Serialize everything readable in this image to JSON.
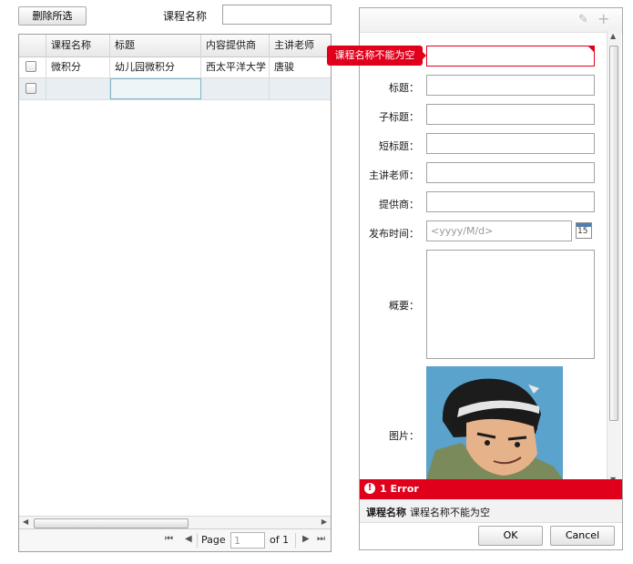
{
  "toolbar": {
    "delete_button": "删除所选",
    "course_name_label": "课程名称",
    "course_name_value": ""
  },
  "grid": {
    "columns": [
      "课程名称",
      "标题",
      "内容提供商",
      "主讲老师"
    ],
    "rows": [
      {
        "cells": [
          "微积分",
          "幼儿园微积分",
          "西太平洋大学",
          "唐骏"
        ]
      },
      {
        "cells": [
          "",
          "",
          "",
          ""
        ]
      }
    ],
    "pager": {
      "page_label": "Page",
      "page_value": "1",
      "of_label": "of 1"
    }
  },
  "form": {
    "error_tooltip": "课程名称不能为空",
    "fields": {
      "title": {
        "label": "标题："
      },
      "subtitle": {
        "label": "子标题："
      },
      "short_title": {
        "label": "短标题："
      },
      "teacher": {
        "label": "主讲老师："
      },
      "provider": {
        "label": "提供商："
      },
      "publish_time": {
        "label": "发布时间：",
        "placeholder": "<yyyy/M/d>"
      },
      "summary": {
        "label": "概要："
      },
      "image": {
        "label": "图片："
      }
    },
    "calendar_day": "15",
    "error_bar": {
      "title": "1 Error"
    },
    "error_detail": {
      "field": "课程名称",
      "message": "课程名称不能为空"
    },
    "ok_button": "OK",
    "cancel_button": "Cancel"
  },
  "colors": {
    "error_red": "#e0001b",
    "selection": "#e9eef2"
  },
  "icons": [
    "pencil-icon",
    "plus-icon",
    "calendar-icon",
    "error-icon",
    "first-page-icon",
    "prev-page-icon",
    "next-page-icon",
    "last-page-icon"
  ]
}
